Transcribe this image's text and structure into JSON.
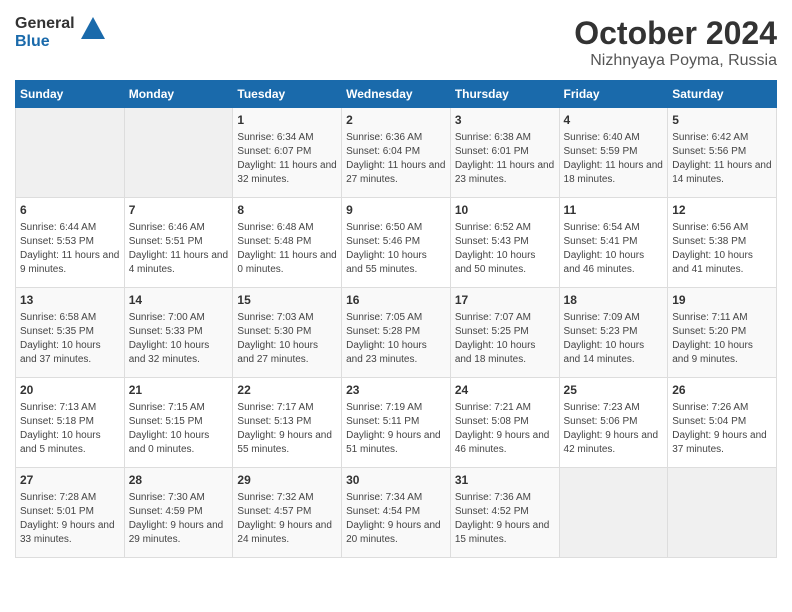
{
  "header": {
    "logo": {
      "general_label": "General",
      "blue_label": "Blue"
    },
    "title": "October 2024",
    "location": "Nizhnyaya Poyma, Russia"
  },
  "days_of_week": [
    "Sunday",
    "Monday",
    "Tuesday",
    "Wednesday",
    "Thursday",
    "Friday",
    "Saturday"
  ],
  "weeks": [
    [
      {
        "day": "",
        "sunrise": "",
        "sunset": "",
        "daylight": "",
        "empty": true
      },
      {
        "day": "",
        "sunrise": "",
        "sunset": "",
        "daylight": "",
        "empty": true
      },
      {
        "day": "1",
        "sunrise": "Sunrise: 6:34 AM",
        "sunset": "Sunset: 6:07 PM",
        "daylight": "Daylight: 11 hours and 32 minutes."
      },
      {
        "day": "2",
        "sunrise": "Sunrise: 6:36 AM",
        "sunset": "Sunset: 6:04 PM",
        "daylight": "Daylight: 11 hours and 27 minutes."
      },
      {
        "day": "3",
        "sunrise": "Sunrise: 6:38 AM",
        "sunset": "Sunset: 6:01 PM",
        "daylight": "Daylight: 11 hours and 23 minutes."
      },
      {
        "day": "4",
        "sunrise": "Sunrise: 6:40 AM",
        "sunset": "Sunset: 5:59 PM",
        "daylight": "Daylight: 11 hours and 18 minutes."
      },
      {
        "day": "5",
        "sunrise": "Sunrise: 6:42 AM",
        "sunset": "Sunset: 5:56 PM",
        "daylight": "Daylight: 11 hours and 14 minutes."
      }
    ],
    [
      {
        "day": "6",
        "sunrise": "Sunrise: 6:44 AM",
        "sunset": "Sunset: 5:53 PM",
        "daylight": "Daylight: 11 hours and 9 minutes."
      },
      {
        "day": "7",
        "sunrise": "Sunrise: 6:46 AM",
        "sunset": "Sunset: 5:51 PM",
        "daylight": "Daylight: 11 hours and 4 minutes."
      },
      {
        "day": "8",
        "sunrise": "Sunrise: 6:48 AM",
        "sunset": "Sunset: 5:48 PM",
        "daylight": "Daylight: 11 hours and 0 minutes."
      },
      {
        "day": "9",
        "sunrise": "Sunrise: 6:50 AM",
        "sunset": "Sunset: 5:46 PM",
        "daylight": "Daylight: 10 hours and 55 minutes."
      },
      {
        "day": "10",
        "sunrise": "Sunrise: 6:52 AM",
        "sunset": "Sunset: 5:43 PM",
        "daylight": "Daylight: 10 hours and 50 minutes."
      },
      {
        "day": "11",
        "sunrise": "Sunrise: 6:54 AM",
        "sunset": "Sunset: 5:41 PM",
        "daylight": "Daylight: 10 hours and 46 minutes."
      },
      {
        "day": "12",
        "sunrise": "Sunrise: 6:56 AM",
        "sunset": "Sunset: 5:38 PM",
        "daylight": "Daylight: 10 hours and 41 minutes."
      }
    ],
    [
      {
        "day": "13",
        "sunrise": "Sunrise: 6:58 AM",
        "sunset": "Sunset: 5:35 PM",
        "daylight": "Daylight: 10 hours and 37 minutes."
      },
      {
        "day": "14",
        "sunrise": "Sunrise: 7:00 AM",
        "sunset": "Sunset: 5:33 PM",
        "daylight": "Daylight: 10 hours and 32 minutes."
      },
      {
        "day": "15",
        "sunrise": "Sunrise: 7:03 AM",
        "sunset": "Sunset: 5:30 PM",
        "daylight": "Daylight: 10 hours and 27 minutes."
      },
      {
        "day": "16",
        "sunrise": "Sunrise: 7:05 AM",
        "sunset": "Sunset: 5:28 PM",
        "daylight": "Daylight: 10 hours and 23 minutes."
      },
      {
        "day": "17",
        "sunrise": "Sunrise: 7:07 AM",
        "sunset": "Sunset: 5:25 PM",
        "daylight": "Daylight: 10 hours and 18 minutes."
      },
      {
        "day": "18",
        "sunrise": "Sunrise: 7:09 AM",
        "sunset": "Sunset: 5:23 PM",
        "daylight": "Daylight: 10 hours and 14 minutes."
      },
      {
        "day": "19",
        "sunrise": "Sunrise: 7:11 AM",
        "sunset": "Sunset: 5:20 PM",
        "daylight": "Daylight: 10 hours and 9 minutes."
      }
    ],
    [
      {
        "day": "20",
        "sunrise": "Sunrise: 7:13 AM",
        "sunset": "Sunset: 5:18 PM",
        "daylight": "Daylight: 10 hours and 5 minutes."
      },
      {
        "day": "21",
        "sunrise": "Sunrise: 7:15 AM",
        "sunset": "Sunset: 5:15 PM",
        "daylight": "Daylight: 10 hours and 0 minutes."
      },
      {
        "day": "22",
        "sunrise": "Sunrise: 7:17 AM",
        "sunset": "Sunset: 5:13 PM",
        "daylight": "Daylight: 9 hours and 55 minutes."
      },
      {
        "day": "23",
        "sunrise": "Sunrise: 7:19 AM",
        "sunset": "Sunset: 5:11 PM",
        "daylight": "Daylight: 9 hours and 51 minutes."
      },
      {
        "day": "24",
        "sunrise": "Sunrise: 7:21 AM",
        "sunset": "Sunset: 5:08 PM",
        "daylight": "Daylight: 9 hours and 46 minutes."
      },
      {
        "day": "25",
        "sunrise": "Sunrise: 7:23 AM",
        "sunset": "Sunset: 5:06 PM",
        "daylight": "Daylight: 9 hours and 42 minutes."
      },
      {
        "day": "26",
        "sunrise": "Sunrise: 7:26 AM",
        "sunset": "Sunset: 5:04 PM",
        "daylight": "Daylight: 9 hours and 37 minutes."
      }
    ],
    [
      {
        "day": "27",
        "sunrise": "Sunrise: 7:28 AM",
        "sunset": "Sunset: 5:01 PM",
        "daylight": "Daylight: 9 hours and 33 minutes."
      },
      {
        "day": "28",
        "sunrise": "Sunrise: 7:30 AM",
        "sunset": "Sunset: 4:59 PM",
        "daylight": "Daylight: 9 hours and 29 minutes."
      },
      {
        "day": "29",
        "sunrise": "Sunrise: 7:32 AM",
        "sunset": "Sunset: 4:57 PM",
        "daylight": "Daylight: 9 hours and 24 minutes."
      },
      {
        "day": "30",
        "sunrise": "Sunrise: 7:34 AM",
        "sunset": "Sunset: 4:54 PM",
        "daylight": "Daylight: 9 hours and 20 minutes."
      },
      {
        "day": "31",
        "sunrise": "Sunrise: 7:36 AM",
        "sunset": "Sunset: 4:52 PM",
        "daylight": "Daylight: 9 hours and 15 minutes."
      },
      {
        "day": "",
        "sunrise": "",
        "sunset": "",
        "daylight": "",
        "empty": true
      },
      {
        "day": "",
        "sunrise": "",
        "sunset": "",
        "daylight": "",
        "empty": true
      }
    ]
  ]
}
